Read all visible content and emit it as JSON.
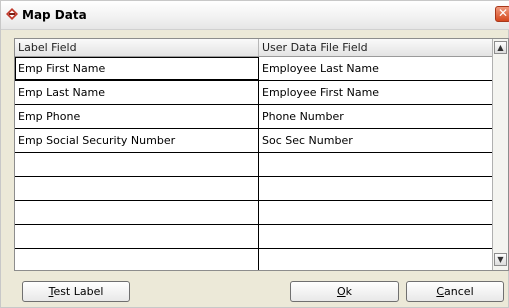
{
  "window": {
    "title": "Map Data"
  },
  "grid": {
    "columns": [
      "Label Field",
      "User Data File Field"
    ],
    "rows": [
      [
        "Emp First Name",
        "Employee Last Name"
      ],
      [
        "Emp Last Name",
        "Employee First Name"
      ],
      [
        "Emp Phone",
        "Phone Number"
      ],
      [
        "Emp Social Security Number",
        "Soc Sec Number"
      ],
      [
        "",
        ""
      ],
      [
        "",
        ""
      ],
      [
        "",
        ""
      ],
      [
        "",
        ""
      ],
      [
        "",
        ""
      ]
    ]
  },
  "buttons": {
    "test_label": {
      "mnemonic": "T",
      "rest": "est Label"
    },
    "ok": {
      "mnemonic": "O",
      "rest": "k"
    },
    "cancel": {
      "mnemonic": "C",
      "rest": "ancel"
    }
  },
  "icons": {
    "app": "map-data-app-icon",
    "close": "close-icon",
    "scroll_up": "scroll-up-arrow-icon",
    "scroll_down": "scroll-down-arrow-icon"
  },
  "colors": {
    "close_button": "#d4471d",
    "dialog_background": "#ece9d8"
  }
}
